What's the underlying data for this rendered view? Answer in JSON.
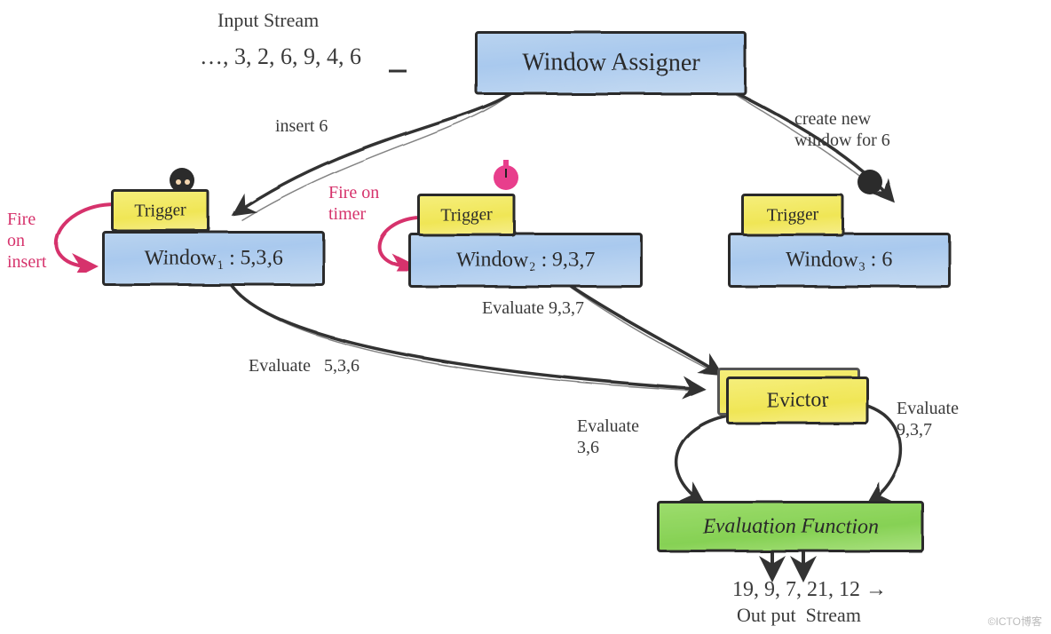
{
  "input_stream_title": "Input Stream",
  "input_stream_values": "…, 3, 2, 6, 9, 4, 6",
  "window_assigner": "Window Assigner",
  "edge_insert6": "insert 6",
  "edge_create_new": "create new\nwindow for 6",
  "trigger1": "Trigger",
  "trigger2": "Trigger",
  "trigger3": "Trigger",
  "window1": "Window₁ : 5,3,6",
  "window2": "Window₂ : 9,3,7",
  "window3": "Window₃ : 6",
  "fire_on_insert": "Fire\non\ninsert",
  "fire_on_timer": "Fire on\ntimer",
  "evaluate_937_top": "Evaluate 9,3,7",
  "evaluate_536": "Evaluate   5,3,6",
  "evictor": "Evictor",
  "evaluate_36": "Evaluate\n3,6",
  "evaluate_937_right": "Evaluate\n9,3,7",
  "evaluation_function": "Evaluation Function",
  "output_values": "19, 9, 7, 21, 12 →",
  "output_title": "Out put  Stream",
  "watermark": "©ICTO博客"
}
